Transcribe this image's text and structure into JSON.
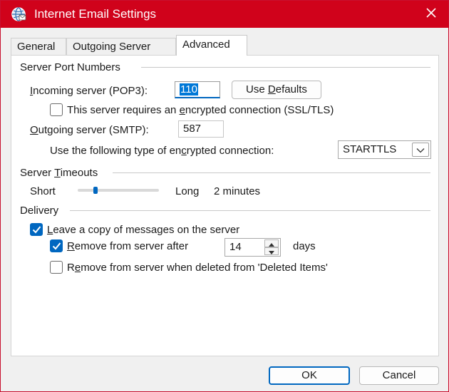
{
  "window": {
    "title": "Internet Email Settings",
    "title_bar_color": "#d0021b",
    "accent_color": "#0067c0"
  },
  "tabs": [
    {
      "label": "General",
      "active": false
    },
    {
      "label": "Outgoing Server",
      "active": false
    },
    {
      "label": "Advanced",
      "active": true
    }
  ],
  "server_ports": {
    "group_label": "Server Port Numbers",
    "incoming_label_pre": "",
    "incoming_label_mnemonic": "I",
    "incoming_label_post": "ncoming server (POP3):",
    "incoming_value": "110",
    "use_defaults_pre": "Use ",
    "use_defaults_mnemonic": "D",
    "use_defaults_post": "efaults",
    "ssl_pre": "This server requires an ",
    "ssl_mnemonic": "e",
    "ssl_post": "ncrypted connection (SSL/TLS)",
    "ssl_checked": false,
    "outgoing_label_pre": "",
    "outgoing_label_mnemonic": "O",
    "outgoing_label_post": "utgoing server (SMTP):",
    "outgoing_value": "587",
    "encryption_label_pre": "Use the following type of en",
    "encryption_label_mnemonic": "c",
    "encryption_label_post": "rypted connection:",
    "encryption_value": "STARTTLS"
  },
  "timeouts": {
    "group_label_pre": "Server ",
    "group_label_mnemonic": "T",
    "group_label_post": "imeouts",
    "short_label": "Short",
    "long_label": "Long",
    "value_text": "2 minutes",
    "slider_fraction": 0.2
  },
  "delivery": {
    "group_label": "Delivery",
    "leave_copy_pre": "",
    "leave_copy_mnemonic": "L",
    "leave_copy_post": "eave a copy of messages on the server",
    "leave_copy_checked": true,
    "remove_after_pre": "",
    "remove_after_mnemonic": "R",
    "remove_after_post": "emove from server after",
    "remove_after_checked": true,
    "days_value": "14",
    "days_label": "days",
    "remove_deleted_pre": "R",
    "remove_deleted_mnemonic": "e",
    "remove_deleted_post": "move from server when deleted from 'Deleted Items'",
    "remove_deleted_checked": false
  },
  "footer": {
    "ok_label": "OK",
    "cancel_label": "Cancel"
  },
  "icons": {
    "title": "outlook-globe-icon",
    "close": "close-icon",
    "check": "checkmark-icon",
    "combo": "chevron-down-icon",
    "spin_up": "triangle-up-icon",
    "spin_down": "triangle-down-icon"
  }
}
